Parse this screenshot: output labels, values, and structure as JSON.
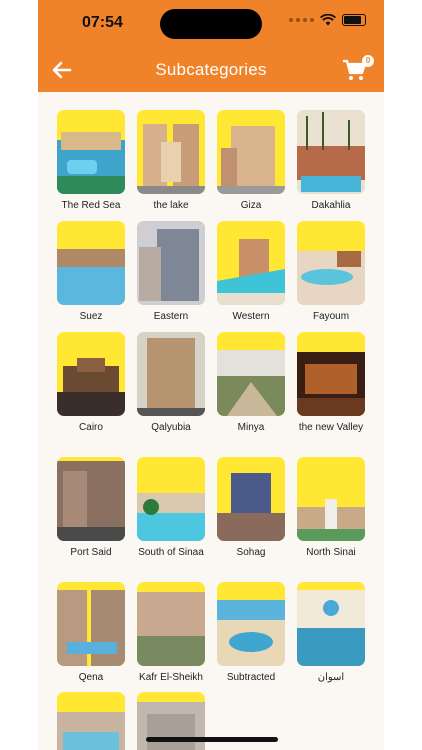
{
  "status": {
    "time": "07:54"
  },
  "header": {
    "title": "Subcategories",
    "cart_count": "0"
  },
  "colors": {
    "header_bg": "#f0832a",
    "thumb_bg": "#ffe733",
    "page_bg": "#fbf8f3"
  },
  "categories": [
    {
      "label": "The Red Sea"
    },
    {
      "label": "the lake"
    },
    {
      "label": "Giza"
    },
    {
      "label": "Dakahlia"
    },
    {
      "label": "Suez"
    },
    {
      "label": "Eastern"
    },
    {
      "label": "Western"
    },
    {
      "label": "Fayoum"
    },
    {
      "label": "Cairo"
    },
    {
      "label": "Qalyubia"
    },
    {
      "label": "Minya"
    },
    {
      "label": "the new Valley"
    },
    {
      "label": "Port Said"
    },
    {
      "label": "South of Sinaa"
    },
    {
      "label": "Sohag"
    },
    {
      "label": "North Sinai"
    },
    {
      "label": "Qena"
    },
    {
      "label": "Kafr El-Sheikh"
    },
    {
      "label": "Subtracted"
    },
    {
      "label": "اسوان"
    },
    {
      "label": ""
    },
    {
      "label": ""
    }
  ]
}
